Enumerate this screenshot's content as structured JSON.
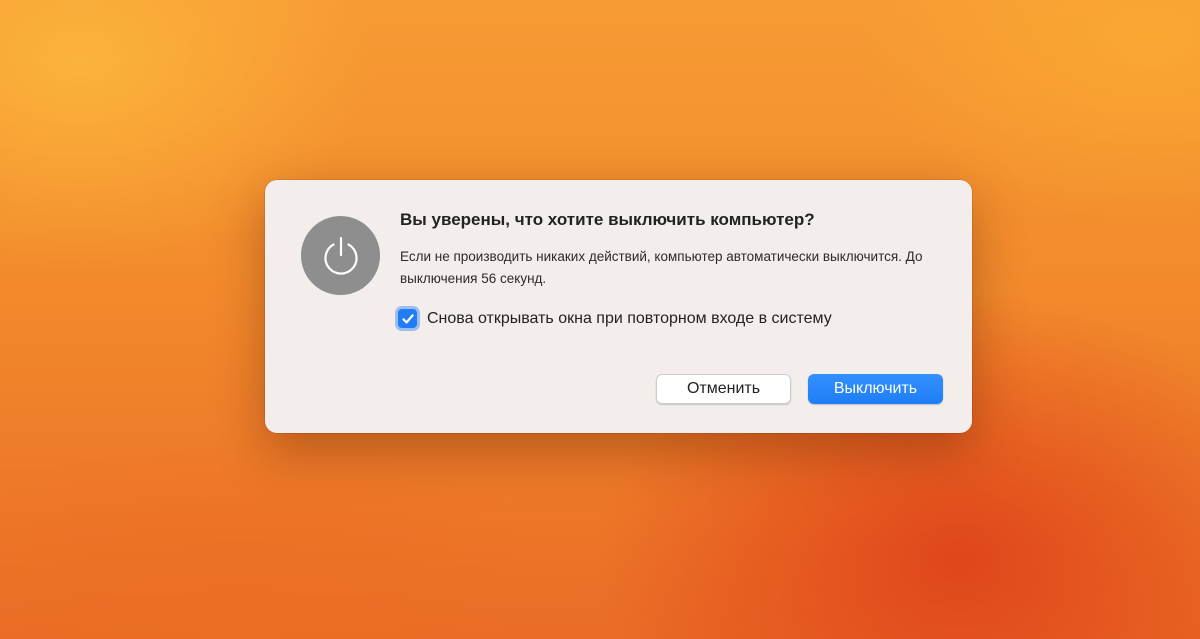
{
  "dialog": {
    "title": "Вы уверены, что хотите выключить компьютер?",
    "message": "Если не производить никаких действий, компьютер автоматически выключится. До выключения 56 секунд.",
    "icon": "power-icon",
    "reopen_windows": {
      "label": "Снова открывать окна при повторном входе в систему",
      "checked": true
    },
    "buttons": {
      "cancel_label": "Отменить",
      "shutdown_label": "Выключить"
    }
  },
  "colors": {
    "accent": "#1f7ef5",
    "dialog_background": "#f3eeeb",
    "icon_background": "#8e8e8e",
    "desktop_orange": "#f28a2c",
    "desktop_red": "#de3e18"
  }
}
